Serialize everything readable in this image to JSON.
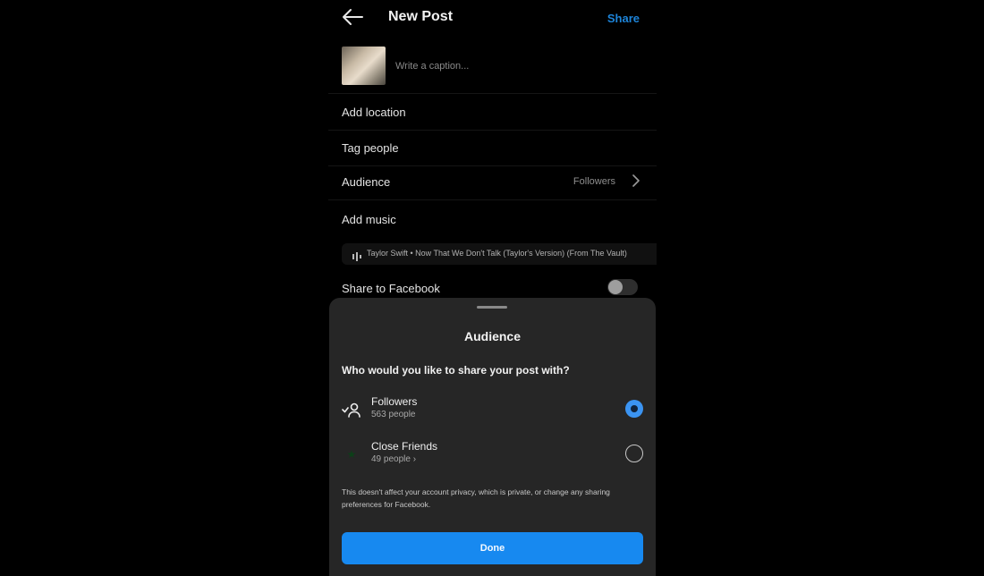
{
  "header": {
    "title": "New Post",
    "share_label": "Share"
  },
  "caption": {
    "placeholder": "Write a caption..."
  },
  "rows": {
    "add_location": "Add location",
    "tag_people": "Tag people",
    "audience_label": "Audience",
    "audience_value": "Followers",
    "add_music": "Add music",
    "music_track": "Taylor Swift • Now That We Don't Talk (Taylor's Version) (From The Vault)",
    "share_to_facebook": "Share to Facebook"
  },
  "toggle": {
    "share_to_facebook_on": false
  },
  "sheet": {
    "title": "Audience",
    "question": "Who would you like to share your post with?",
    "options": [
      {
        "name": "Followers",
        "count": "563 people",
        "selected": true,
        "icon": "followers-icon"
      },
      {
        "name": "Close Friends",
        "count": "49 people",
        "selected": false,
        "icon": "star-icon"
      }
    ],
    "note": "This doesn't affect your account privacy, which is private, or change any sharing preferences for Facebook.",
    "done_label": "Done"
  },
  "colors": {
    "accent": "#1789f0",
    "close_friends_green": "#1fbf4b",
    "sheet_bg": "#262626"
  }
}
